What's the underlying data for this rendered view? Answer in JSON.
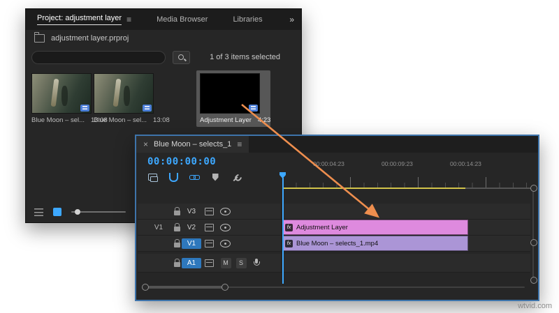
{
  "watermark": "wtvid.com",
  "colors": {
    "accent_blue": "#3da8ff",
    "track_target_blue": "#2e78bd",
    "timeline_border_blue": "#3e74ab",
    "clip_pink": "#de8ade",
    "clip_purple": "#ab95d6",
    "arrow_orange": "#ee8e4e",
    "work_area_yellow": "#d2c44a"
  },
  "project_panel": {
    "tabs": {
      "project": "Project: adjustment layer",
      "media_browser": "Media Browser",
      "libraries": "Libraries",
      "overflow": "»"
    },
    "menu_icon": "≡",
    "breadcrumb": "adjustment layer.prproj",
    "search": {
      "value": "",
      "placeholder": ""
    },
    "selection_status": "1 of 3 items selected",
    "items": [
      {
        "label": "Blue Moon – sel...",
        "duration": "13:08",
        "selected": false
      },
      {
        "label": "Blue Moon – sel...",
        "duration": "13:08",
        "selected": false
      },
      {
        "label": "Adjustment Layer",
        "duration": "4:23",
        "selected": true
      }
    ]
  },
  "timeline_panel": {
    "close_icon": "×",
    "tab_label": "Blue Moon – selects_1",
    "menu_icon": "≡",
    "timecode": "00:00:00:00",
    "ruler_labels": [
      "00:00:04:23",
      "00:00:09:23",
      "00:00:14:23"
    ],
    "tracks": {
      "v3": {
        "name": "V3"
      },
      "v2": {
        "name": "V2",
        "source_patch": "V1"
      },
      "v1": {
        "name": "V1",
        "targeted": true
      },
      "a1": {
        "name": "A1",
        "targeted": true,
        "mute": "M",
        "solo": "S"
      }
    },
    "clips": [
      {
        "label": "Adjustment Layer",
        "badge": "fx",
        "track": "V2"
      },
      {
        "label": "Blue Moon – selects_1.mp4",
        "badge": "fx",
        "track": "V1"
      }
    ]
  }
}
